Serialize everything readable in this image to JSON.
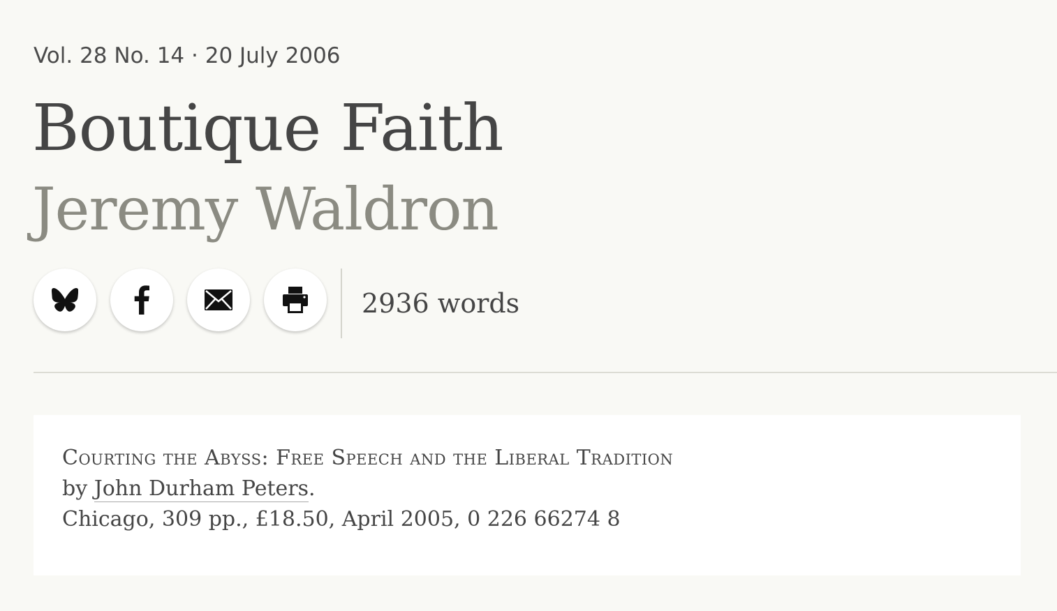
{
  "issue": {
    "volume_line": "Vol. 28 No. 14 · 20 July 2006"
  },
  "article": {
    "title": "Boutique Faith",
    "author": "Jeremy Waldron",
    "word_count": "2936 words"
  },
  "share": {
    "buttons": [
      {
        "icon": "butterfly-icon"
      },
      {
        "icon": "facebook-icon"
      },
      {
        "icon": "email-icon"
      },
      {
        "icon": "print-icon"
      }
    ]
  },
  "book": {
    "title": "Courting the Abyss: Free Speech and the Liberal Tradition",
    "by_prefix": "by",
    "author": "John Durham Peters",
    "author_suffix": ".",
    "publication": "Chicago, 309 pp., £18.50, April 2005, 0 226 66274 8"
  },
  "colors": {
    "background": "#f9f9f5",
    "title_text": "#454545",
    "author_text": "#8b8b82",
    "book_box": "#ffffff"
  }
}
